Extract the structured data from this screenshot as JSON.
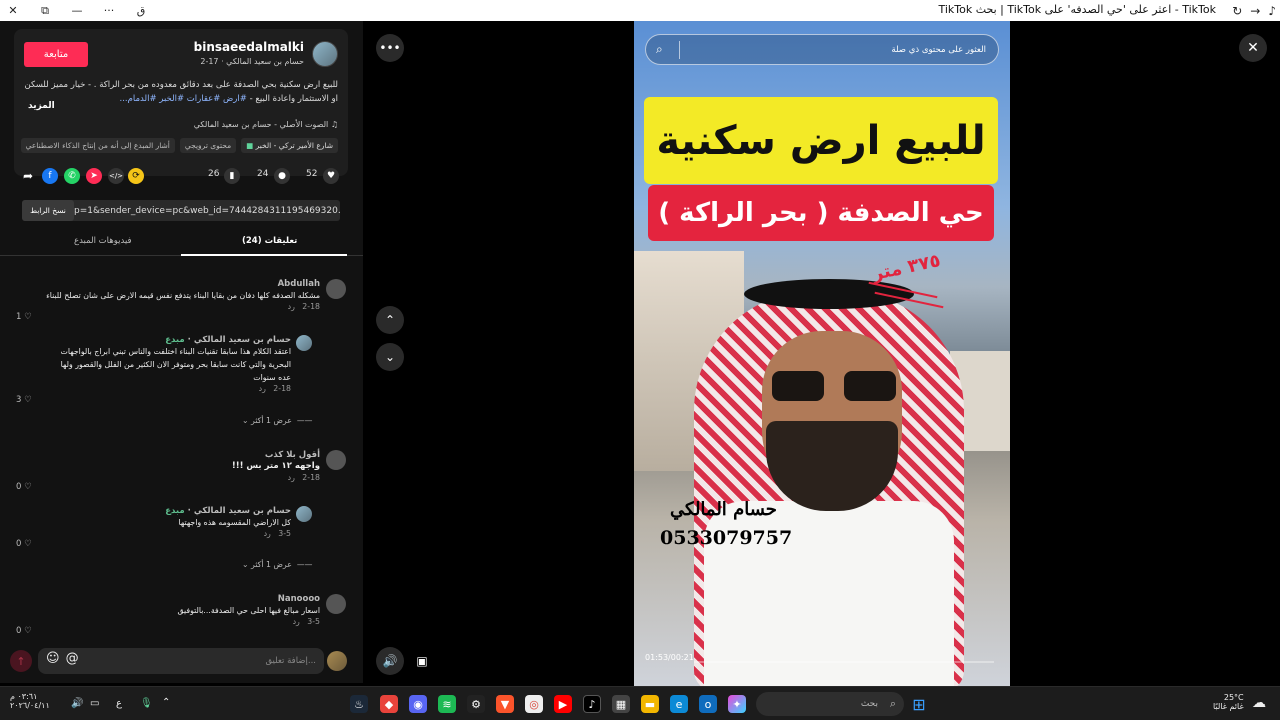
{
  "window": {
    "title": "TikTok بحث | TikTok اعثر على 'حي الصدفه' على - TikTok",
    "close_label": "✕",
    "restore_label": "⧉",
    "minimize_label": "—",
    "menu_label": "···",
    "lang_label": "ق",
    "reload_label": "↻",
    "forward_label": "→"
  },
  "post": {
    "username": "binsaeedalmalki",
    "subline": "حسام بن سعيد المالكي · 17-2",
    "follow_label": "متابعة",
    "description": "للبيع ارض سكنية بحي الصدفة على بعد دقائق معدوده من بحر الراكة . - خيار مميز للسكن او الاستثمار واعادة البيع -",
    "tags": "#ارض #عقارات #الخبر #الدمام...",
    "more_label": "المزيد",
    "sound": "الصوت الأصلي - حسام بن سعيد المالكي",
    "chips": [
      "شارع الأمير تركي - الخبر",
      "محتوى ترويجي",
      "أشار المبدع إلى أنه من إنتاج الذكاء الاصطناعي"
    ],
    "likes": "52",
    "comments": "24",
    "saves": "26",
    "copy_label": "نسخ الرابط",
    "url": "p=1&sender_device=pc&web_id=7444284311195469320..."
  },
  "tabs": {
    "comments": "تعليقات (24)",
    "creator_videos": "فيديوهات المبدع"
  },
  "comments": [
    {
      "name": "Abdullah",
      "text": "مشكله الصدفه كلها دفان من بقايا البناء يتدفع نفس قيمه الارض على شان تصلح للبناء",
      "date": "2-18",
      "reply": "رد",
      "likes": "1"
    },
    {
      "name": "حسام بن سعيد المالكي",
      "creator": "مبدع",
      "text": "اعتقد الكلام هذا سابقا تقنيات البناء اختلفت والناس تبني ابراج بالواجهات البحرية والتي كانت سابقا بحر ومتوفر الان الكثير من الفلل والقصور ولها عده سنوات",
      "date": "2-18",
      "reply": "رد",
      "likes": "3"
    },
    {
      "name": "أقول بلا كذب",
      "text": "واجهه ١٢ متر بس !!!",
      "date": "2-18",
      "reply": "رد",
      "likes": "0"
    },
    {
      "name": "حسام بن سعيد المالكي",
      "creator": "مبدع",
      "text": "كل الاراضي المقسومه هذه واجهتها",
      "date": "3-5",
      "reply": "رد",
      "likes": "0"
    },
    {
      "name": "Nanoooo",
      "text": "اسعار مبالغ فيها احلى حي الصدفة...بالتوفيق",
      "date": "3-5",
      "reply": "رد",
      "likes": "0"
    }
  ],
  "view_more": "عرض 1 أكثر",
  "comment_input": {
    "placeholder": "إضافة تعليق..."
  },
  "video": {
    "search_placeholder": "العثور على محتوى ذي صلة",
    "headline": "للبيع ارض سكنية",
    "subheadline": "حي الصدفة ( بحر الراكة )",
    "area": "٣٧٥ متر",
    "signature": "حسام المالكي",
    "phone": "0533079757",
    "time": "01:53/00:21"
  },
  "taskbar": {
    "search_label": "بحث",
    "weather_temp": "25°C",
    "weather_text": "غائم غالبًا",
    "clock_time": "٠٣:٦١ م",
    "clock_date": "٢٠٢٦/٠٤/١١",
    "lang": "ع"
  },
  "colors": {
    "accent": "#fe2c55",
    "yellow": "#f3ea26",
    "red": "#e4243e"
  }
}
